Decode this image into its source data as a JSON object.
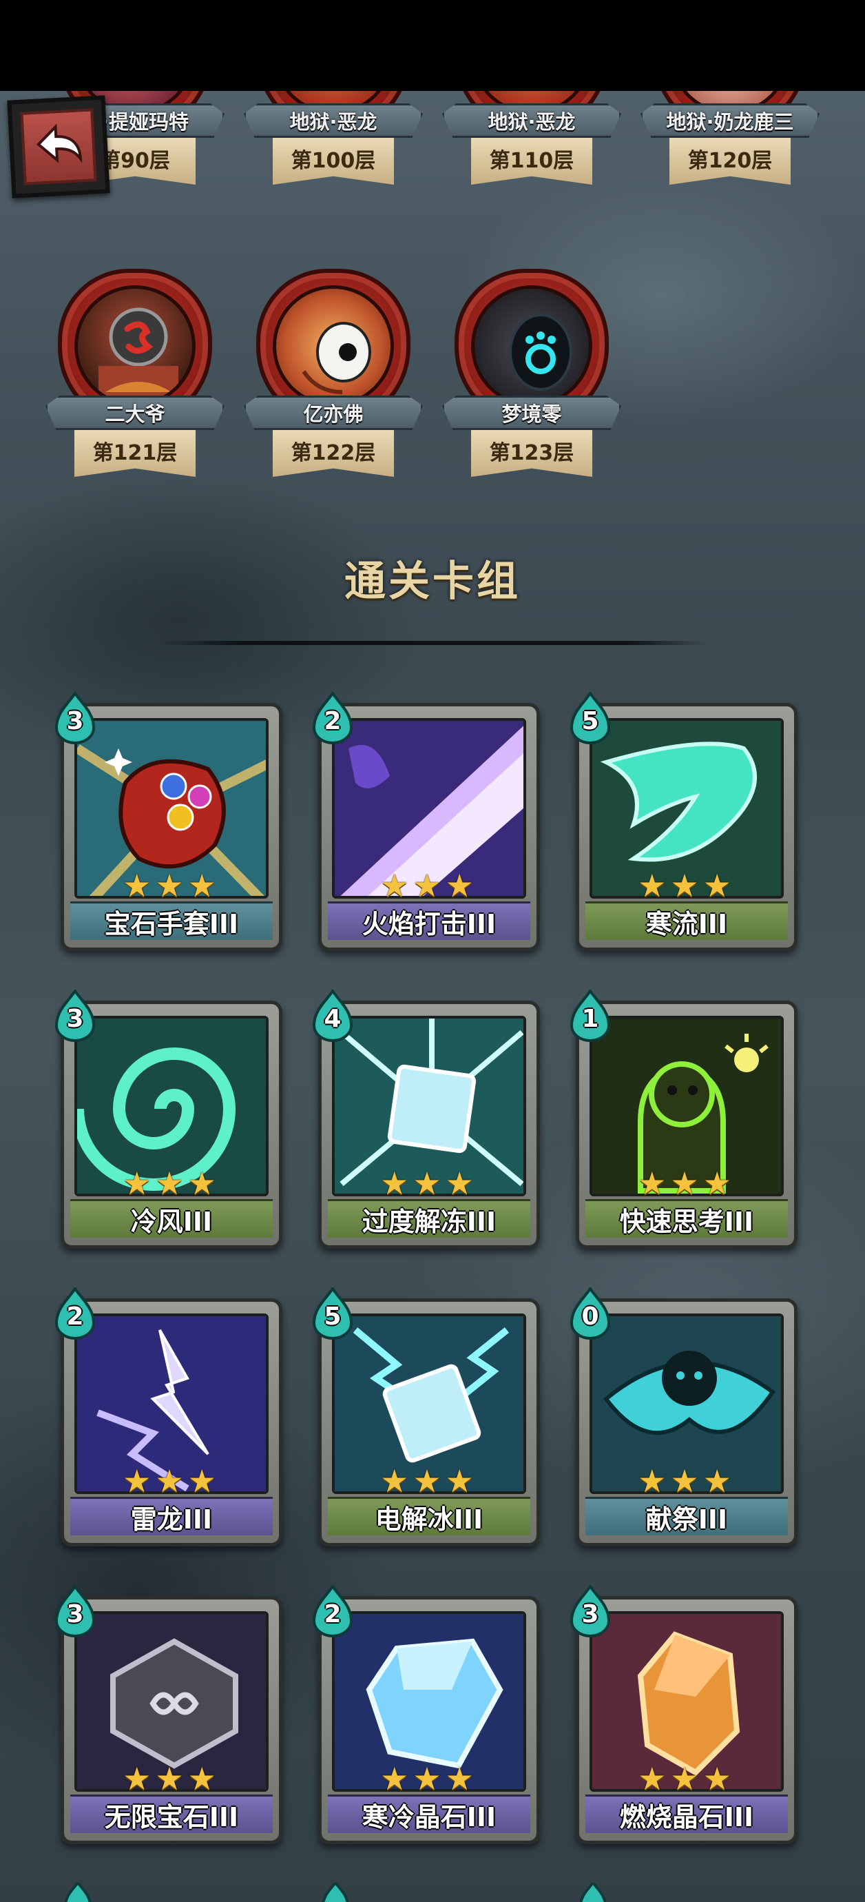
{
  "bosses_top_row": [
    {
      "name": "…·提娅玛特",
      "floor": "第90层"
    },
    {
      "name": "地狱·恶龙",
      "floor": "第100层"
    },
    {
      "name": "地狱·恶龙",
      "floor": "第110层"
    },
    {
      "name": "地狱·奶龙鹿三",
      "floor": "第120层"
    }
  ],
  "bosses_second_row": [
    {
      "name": "二大爷",
      "floor": "第121层"
    },
    {
      "name": "亿亦佛",
      "floor": "第122层"
    },
    {
      "name": "梦境零",
      "floor": "第123层"
    }
  ],
  "section_title": "通关卡组",
  "star_glyph": "★★★",
  "cards": [
    {
      "cost": "3",
      "name": "宝石手套III",
      "bar": "blue",
      "art": "gauntlet"
    },
    {
      "cost": "2",
      "name": "火焰打击III",
      "bar": "purple",
      "art": "purple-slash"
    },
    {
      "cost": "5",
      "name": "寒流III",
      "bar": "green",
      "art": "cyan-flame"
    },
    {
      "cost": "3",
      "name": "冷风III",
      "bar": "green",
      "art": "green-vortex"
    },
    {
      "cost": "4",
      "name": "过度解冻III",
      "bar": "green",
      "art": "ice-burst"
    },
    {
      "cost": "1",
      "name": "快速思考III",
      "bar": "green",
      "art": "thinker"
    },
    {
      "cost": "2",
      "name": "雷龙III",
      "bar": "purple",
      "art": "thunder-dragon"
    },
    {
      "cost": "5",
      "name": "电解冰III",
      "bar": "green",
      "art": "electric-ice"
    },
    {
      "cost": "0",
      "name": "献祭III",
      "bar": "blue",
      "art": "sacrifice"
    },
    {
      "cost": "3",
      "name": "无限宝石III",
      "bar": "purple",
      "art": "infinity-gem"
    },
    {
      "cost": "2",
      "name": "寒冷晶石III",
      "bar": "purple",
      "art": "ice-crystal"
    },
    {
      "cost": "3",
      "name": "燃烧晶石III",
      "bar": "purple",
      "art": "fire-crystal"
    }
  ],
  "colors": {
    "title": "#e8d5a6",
    "star": "#f4c23c",
    "cost_drop": "#2fbfb1",
    "boss_shield": "#8f1f18"
  }
}
